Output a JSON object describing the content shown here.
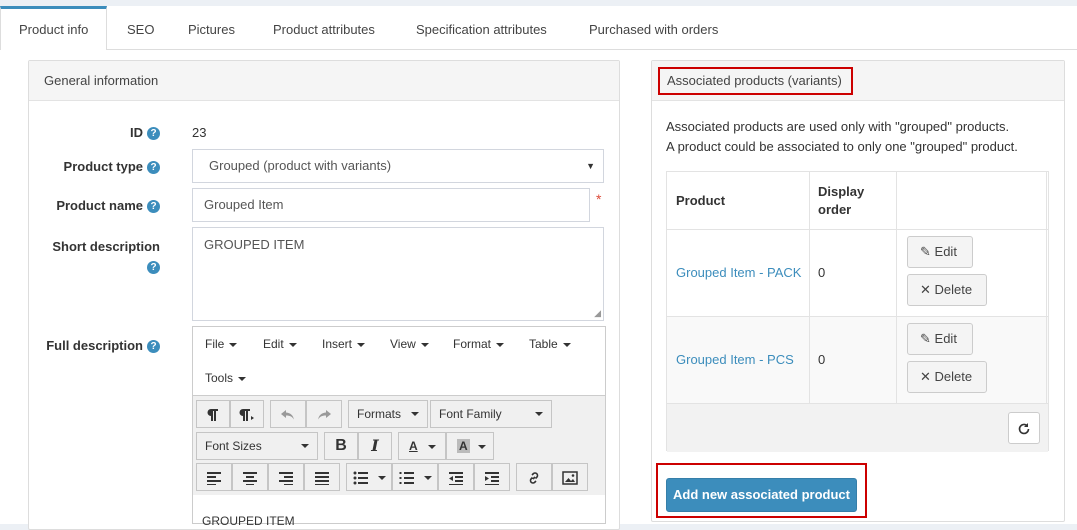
{
  "tabs": [
    "Product info",
    "SEO",
    "Pictures",
    "Product attributes",
    "Specification attributes",
    "Purchased with orders"
  ],
  "general": {
    "title": "General information",
    "id_label": "ID",
    "id_value": "23",
    "product_type_label": "Product type",
    "product_type_value": "Grouped (product with variants)",
    "product_name_label": "Product name",
    "product_name_value": "Grouped Item",
    "required_mark": "*",
    "short_desc_label": "Short description",
    "short_desc_value": "GROUPED ITEM",
    "full_desc_label": "Full description",
    "editor": {
      "menus": [
        "File",
        "Edit",
        "Insert",
        "View",
        "Format",
        "Table",
        "Tools"
      ],
      "formats_label": "Formats",
      "font_family_label": "Font Family",
      "font_sizes_label": "Font Sizes",
      "bold": "B",
      "italic": "I",
      "text_color": "A",
      "bg_color": "A",
      "content": "GROUPED ITEM"
    }
  },
  "associated": {
    "title": "Associated products (variants)",
    "description": [
      "Associated products are used only with \"grouped\" products.",
      "A product could be associated to only one \"grouped\" product."
    ],
    "columns": {
      "product": "Product",
      "display_order_1": "Display",
      "display_order_2": "order"
    },
    "rows": [
      {
        "product": "Grouped Item - PACK",
        "display_order": "0",
        "edit": "Edit",
        "delete": "Delete"
      },
      {
        "product": "Grouped Item - PCS",
        "display_order": "0",
        "edit": "Edit",
        "delete": "Delete"
      }
    ],
    "add_button": "Add new associated product"
  },
  "colors": {
    "accent": "#3c8dbc",
    "highlight": "#c00000",
    "required": "#dd4b39"
  }
}
